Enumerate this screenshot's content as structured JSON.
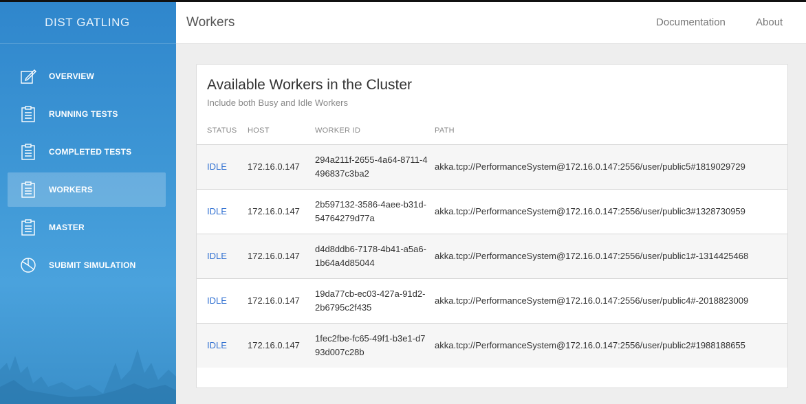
{
  "app": {
    "name": "DIST GATLING"
  },
  "sidebar": {
    "items": [
      {
        "label": "OVERVIEW",
        "icon": "edit-icon",
        "active": false
      },
      {
        "label": "RUNNING TESTS",
        "icon": "clipboard-icon",
        "active": false
      },
      {
        "label": "COMPLETED TESTS",
        "icon": "clipboard-icon",
        "active": false
      },
      {
        "label": "WORKERS",
        "icon": "clipboard-icon",
        "active": true
      },
      {
        "label": "MASTER",
        "icon": "clipboard-icon",
        "active": false
      },
      {
        "label": "SUBMIT SIMULATION",
        "icon": "pie-chart-icon",
        "active": false
      }
    ]
  },
  "header": {
    "title": "Workers",
    "links": [
      "Documentation",
      "About"
    ]
  },
  "card": {
    "title": "Available Workers in the Cluster",
    "subtitle": "Include both Busy and Idle Workers"
  },
  "table": {
    "columns": [
      "STATUS",
      "HOST",
      "WORKER ID",
      "PATH"
    ],
    "rows": [
      {
        "status": "IDLE",
        "host": "172.16.0.147",
        "worker_id": "294a211f-2655-4a64-8711-4496837c3ba2",
        "path": "akka.tcp://PerformanceSystem@172.16.0.147:2556/user/public5#1819029729"
      },
      {
        "status": "IDLE",
        "host": "172.16.0.147",
        "worker_id": "2b597132-3586-4aee-b31d-54764279d77a",
        "path": "akka.tcp://PerformanceSystem@172.16.0.147:2556/user/public3#1328730959"
      },
      {
        "status": "IDLE",
        "host": "172.16.0.147",
        "worker_id": "d4d8ddb6-7178-4b41-a5a6-1b64a4d85044",
        "path": "akka.tcp://PerformanceSystem@172.16.0.147:2556/user/public1#-1314425468"
      },
      {
        "status": "IDLE",
        "host": "172.16.0.147",
        "worker_id": "19da77cb-ec03-427a-91d2-2b6795c2f435",
        "path": "akka.tcp://PerformanceSystem@172.16.0.147:2556/user/public4#-2018823009"
      },
      {
        "status": "IDLE",
        "host": "172.16.0.147",
        "worker_id": "1fec2fbe-fc65-49f1-b3e1-d793d007c28b",
        "path": "akka.tcp://PerformanceSystem@172.16.0.147:2556/user/public2#1988188655"
      }
    ]
  },
  "colors": {
    "sidebar": "#3f98d6",
    "status": "#2f6fd1",
    "background": "#eeeeee"
  }
}
